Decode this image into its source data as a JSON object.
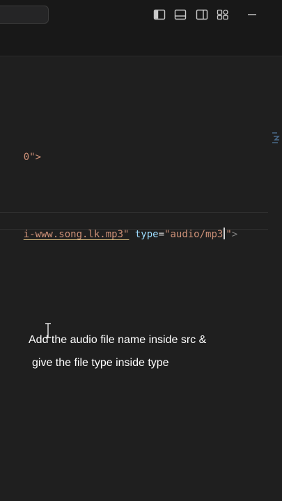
{
  "editor": {
    "fragment_top": "0\">",
    "code_line": {
      "src_value": "i-www.song.lk.mp3\"",
      "type_attr": "type",
      "equals": "=",
      "type_value_part1": "\"audio/mp3",
      "type_value_part2": "\"",
      "tag_close": ">"
    }
  },
  "caption": {
    "line1": "Add the audio file name inside src &",
    "line2": "give the file type inside type"
  },
  "icons": [
    "toggle-primary-sidebar-icon",
    "toggle-panel-icon",
    "toggle-secondary-sidebar-icon",
    "customize-layout-icon",
    "minimize-icon"
  ],
  "colors": {
    "editor_bg": "#1f1f1f",
    "titlebar_bg": "#181818",
    "string": "#ce9178",
    "attribute": "#9cdcfe"
  }
}
